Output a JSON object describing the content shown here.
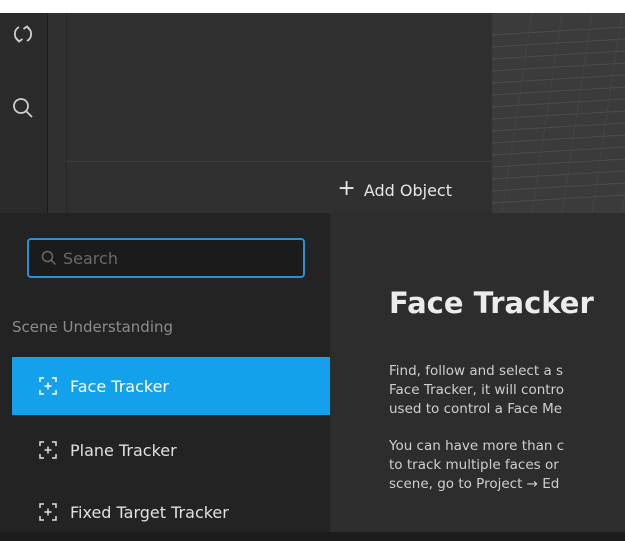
{
  "toolbar": {
    "tools": [
      {
        "icon": "rotate-arrows-icon"
      },
      {
        "icon": "search-icon"
      }
    ]
  },
  "scene": {
    "add_object_label": "Add Object",
    "add_object_icon": "plus-icon"
  },
  "search": {
    "placeholder": "Search",
    "value": ""
  },
  "sidebar": {
    "section_label": "Scene Understanding",
    "items": [
      {
        "label": "Face Tracker",
        "icon": "tracker-icon",
        "selected": true
      },
      {
        "label": "Plane Tracker",
        "icon": "tracker-icon",
        "selected": false
      },
      {
        "label": "Fixed Target Tracker",
        "icon": "tracker-icon",
        "selected": false
      }
    ]
  },
  "detail": {
    "title": "Face Tracker",
    "para1": [
      "Find, follow and select a s",
      "Face Tracker, it will contro",
      "used to control a Face Me"
    ],
    "para2": [
      "You can have more than c",
      "to track multiple faces or",
      "scene, go to Project → Ed"
    ]
  },
  "colors": {
    "accent": "#12a1ea",
    "focus_border": "#2a8fd6"
  }
}
